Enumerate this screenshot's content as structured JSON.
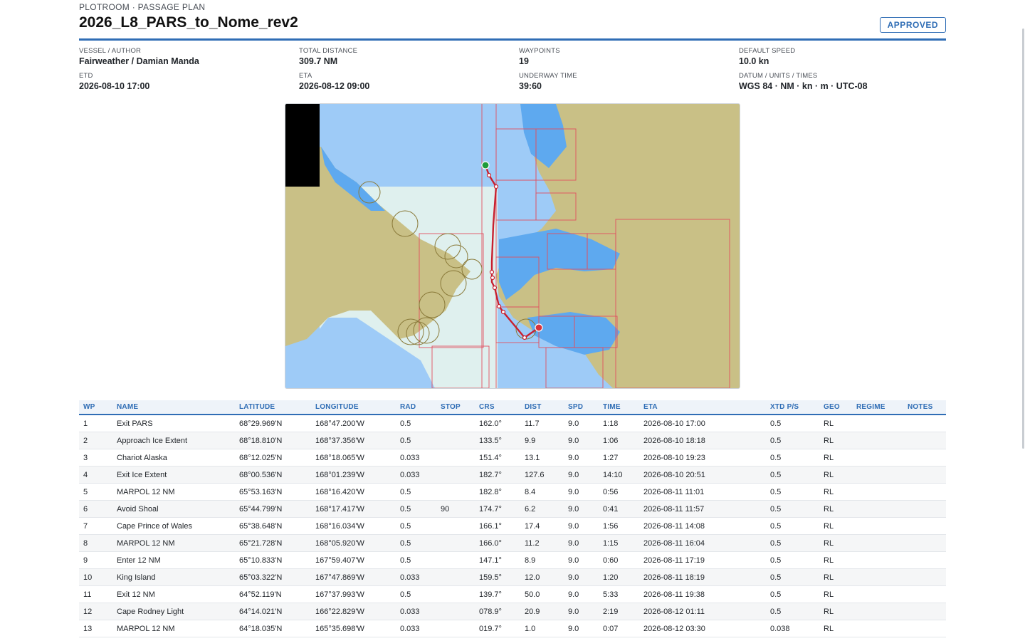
{
  "header": {
    "breadcrumb": "PLOTROOM · PASSAGE PLAN",
    "title": "2026_L8_PARS_to_Nome_rev2",
    "status": "APPROVED"
  },
  "meta": [
    {
      "label": "VESSEL / AUTHOR",
      "value": "Fairweather / Damian Manda"
    },
    {
      "label": "TOTAL DISTANCE",
      "value": "309.7 NM"
    },
    {
      "label": "WAYPOINTS",
      "value": "19"
    },
    {
      "label": "DEFAULT SPEED",
      "value": "10.0 kn"
    },
    {
      "label": "ETD",
      "value": "2026-08-10 17:00"
    },
    {
      "label": "ETA",
      "value": "2026-08-12 09:00"
    },
    {
      "label": "UNDERWAY TIME",
      "value": "39:60"
    },
    {
      "label": "DATUM / UNITS / TIMES",
      "value": "WGS 84 · NM · kn · m · UTC-08"
    }
  ],
  "colors": {
    "accent": "#2f6db5",
    "route": "#c8202f",
    "start_marker": "#1e9b3a",
    "end_marker": "#d8323b",
    "land": "#c9c086",
    "water_deep": "#9ecbf7",
    "water_shallow": "#5ea9ef",
    "chart_grid": "#e05060"
  },
  "table": {
    "columns": [
      "WP",
      "NAME",
      "LATITUDE",
      "LONGITUDE",
      "RAD",
      "STOP",
      "CRS",
      "DIST",
      "SPD",
      "TIME",
      "ETA",
      "XTD P/S",
      "GEO",
      "REGIME",
      "NOTES"
    ],
    "rows": [
      [
        "1",
        "Exit PARS",
        "68°29.969'N",
        "168°47.200'W",
        "0.5",
        "",
        "162.0°",
        "11.7",
        "9.0",
        "1:18",
        "2026-08-10 17:00",
        "0.5",
        "RL",
        "",
        ""
      ],
      [
        "2",
        "Approach Ice Extent",
        "68°18.810'N",
        "168°37.356'W",
        "0.5",
        "",
        "133.5°",
        "9.9",
        "9.0",
        "1:06",
        "2026-08-10 18:18",
        "0.5",
        "RL",
        "",
        ""
      ],
      [
        "3",
        "Chariot Alaska",
        "68°12.025'N",
        "168°18.065'W",
        "0.033",
        "",
        "151.4°",
        "13.1",
        "9.0",
        "1:27",
        "2026-08-10 19:23",
        "0.5",
        "RL",
        "",
        ""
      ],
      [
        "4",
        "Exit Ice Extent",
        "68°00.536'N",
        "168°01.239'W",
        "0.033",
        "",
        "182.7°",
        "127.6",
        "9.0",
        "14:10",
        "2026-08-10 20:51",
        "0.5",
        "RL",
        "",
        ""
      ],
      [
        "5",
        "MARPOL 12 NM",
        "65°53.163'N",
        "168°16.420'W",
        "0.5",
        "",
        "182.8°",
        "8.4",
        "9.0",
        "0:56",
        "2026-08-11 11:01",
        "0.5",
        "RL",
        "",
        ""
      ],
      [
        "6",
        "Avoid Shoal",
        "65°44.799'N",
        "168°17.417'W",
        "0.5",
        "90",
        "174.7°",
        "6.2",
        "9.0",
        "0:41",
        "2026-08-11 11:57",
        "0.5",
        "RL",
        "",
        ""
      ],
      [
        "7",
        "Cape Prince of Wales",
        "65°38.648'N",
        "168°16.034'W",
        "0.5",
        "",
        "166.1°",
        "17.4",
        "9.0",
        "1:56",
        "2026-08-11 14:08",
        "0.5",
        "RL",
        "",
        ""
      ],
      [
        "8",
        "MARPOL 12 NM",
        "65°21.728'N",
        "168°05.920'W",
        "0.5",
        "",
        "166.0°",
        "11.2",
        "9.0",
        "1:15",
        "2026-08-11 16:04",
        "0.5",
        "RL",
        "",
        ""
      ],
      [
        "9",
        "Enter 12 NM",
        "65°10.833'N",
        "167°59.407'W",
        "0.5",
        "",
        "147.1°",
        "8.9",
        "9.0",
        "0:60",
        "2026-08-11 17:19",
        "0.5",
        "RL",
        "",
        ""
      ],
      [
        "10",
        "King Island",
        "65°03.322'N",
        "167°47.869'W",
        "0.033",
        "",
        "159.5°",
        "12.0",
        "9.0",
        "1:20",
        "2026-08-11 18:19",
        "0.5",
        "RL",
        "",
        ""
      ],
      [
        "11",
        "Exit 12 NM",
        "64°52.119'N",
        "167°37.993'W",
        "0.5",
        "",
        "139.7°",
        "50.0",
        "9.0",
        "5:33",
        "2026-08-11 19:38",
        "0.5",
        "RL",
        "",
        ""
      ],
      [
        "12",
        "Cape Rodney Light",
        "64°14.021'N",
        "166°22.829'W",
        "0.033",
        "",
        "078.9°",
        "20.9",
        "9.0",
        "2:19",
        "2026-08-12 01:11",
        "0.5",
        "RL",
        "",
        ""
      ],
      [
        "13",
        "MARPOL 12 NM",
        "64°18.035'N",
        "165°35.698'W",
        "0.033",
        "",
        "019.7°",
        "1.0",
        "9.0",
        "0:07",
        "2026-08-12 03:30",
        "0.038",
        "RL",
        "",
        ""
      ]
    ]
  }
}
